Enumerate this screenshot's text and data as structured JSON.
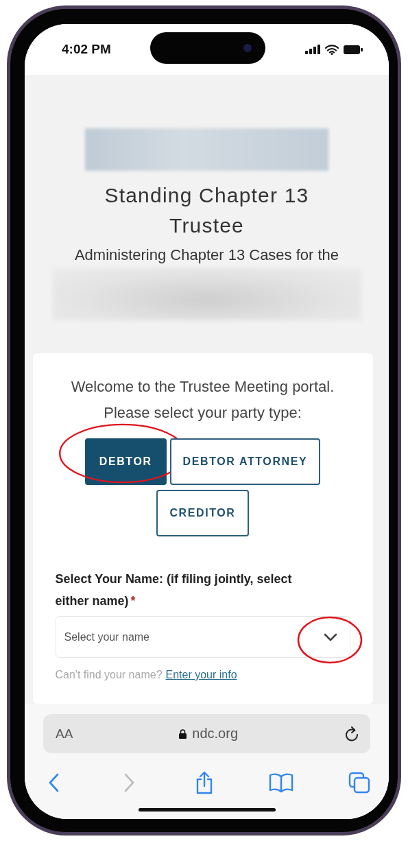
{
  "status_bar": {
    "time": "4:02 PM"
  },
  "header": {
    "title": "Standing Chapter 13 Trustee",
    "subtitle": "Administering Chapter 13 Cases for the"
  },
  "card": {
    "intro": [
      "Welcome to the Trustee Meeting portal.",
      "Please select your party type:"
    ],
    "party_types": [
      {
        "label": "DEBTOR",
        "selected": true,
        "circled": true
      },
      {
        "label": "DEBTOR ATTORNEY",
        "selected": false,
        "circled": false
      },
      {
        "label": "CREDITOR",
        "selected": false,
        "circled": false
      }
    ],
    "name_field": {
      "label": "Select Your Name: (if filing jointly, select either name)",
      "required_mark": "*",
      "placeholder": "Select your name",
      "circled": true
    },
    "help": {
      "text": "Can't find your name?",
      "link": "Enter your info"
    }
  },
  "browser": {
    "text_size": "AA",
    "url": "ndc.org",
    "toolbar": [
      {
        "kind": "back",
        "disabled": false
      },
      {
        "kind": "forward",
        "disabled": true
      },
      {
        "kind": "share",
        "disabled": false
      },
      {
        "kind": "bookmarks",
        "disabled": false
      },
      {
        "kind": "tabs",
        "disabled": false
      }
    ]
  }
}
